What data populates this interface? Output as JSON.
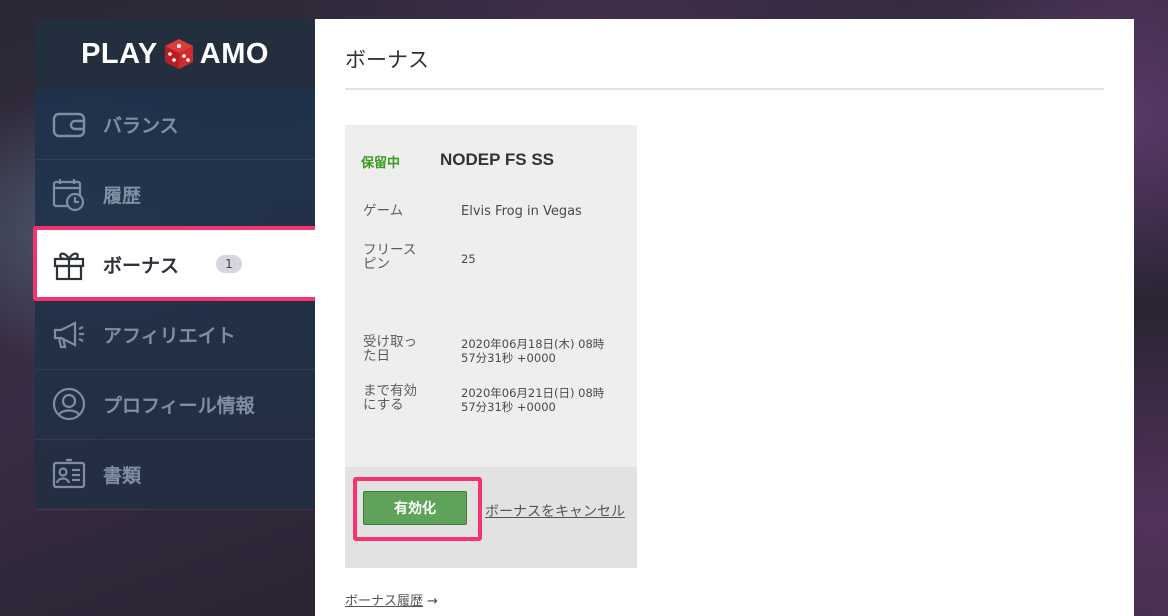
{
  "logo": {
    "left": "PLAY",
    "right": "AMO"
  },
  "sidebar": {
    "items": [
      {
        "label": "バランス",
        "icon": "wallet-icon"
      },
      {
        "label": "履歴",
        "icon": "calendar-clock-icon"
      },
      {
        "label": "ボーナス",
        "icon": "gift-icon",
        "badge": "1",
        "active": true
      },
      {
        "label": "アフィリエイト",
        "icon": "megaphone-icon"
      },
      {
        "label": "プロフィール情報",
        "icon": "user-icon"
      },
      {
        "label": "書類",
        "icon": "id-card-icon"
      }
    ]
  },
  "main": {
    "title": "ボーナス",
    "card": {
      "status": "保留中",
      "name": "NODEP FS SS",
      "rows": [
        {
          "label": "ゲーム",
          "value": "Elvis Frog in Vegas"
        },
        {
          "label": "フリースピン",
          "value": "25"
        },
        {
          "label": "受け取った日",
          "value": "2020年06月18日(木) 08時57分31秒 +0000"
        },
        {
          "label": "まで有効にする",
          "value": "2020年06月21日(日) 08時57分31秒 +0000"
        }
      ],
      "activate_label": "有効化",
      "cancel_label": "ボーナスをキャンセル"
    },
    "history_link": "ボーナス履歴",
    "history_arrow": "→"
  },
  "colors": {
    "highlight": "#f4336f",
    "status_green": "#3a9c1e",
    "button_green": "#5fa35a",
    "sidebar_bg": "#1f344e"
  }
}
